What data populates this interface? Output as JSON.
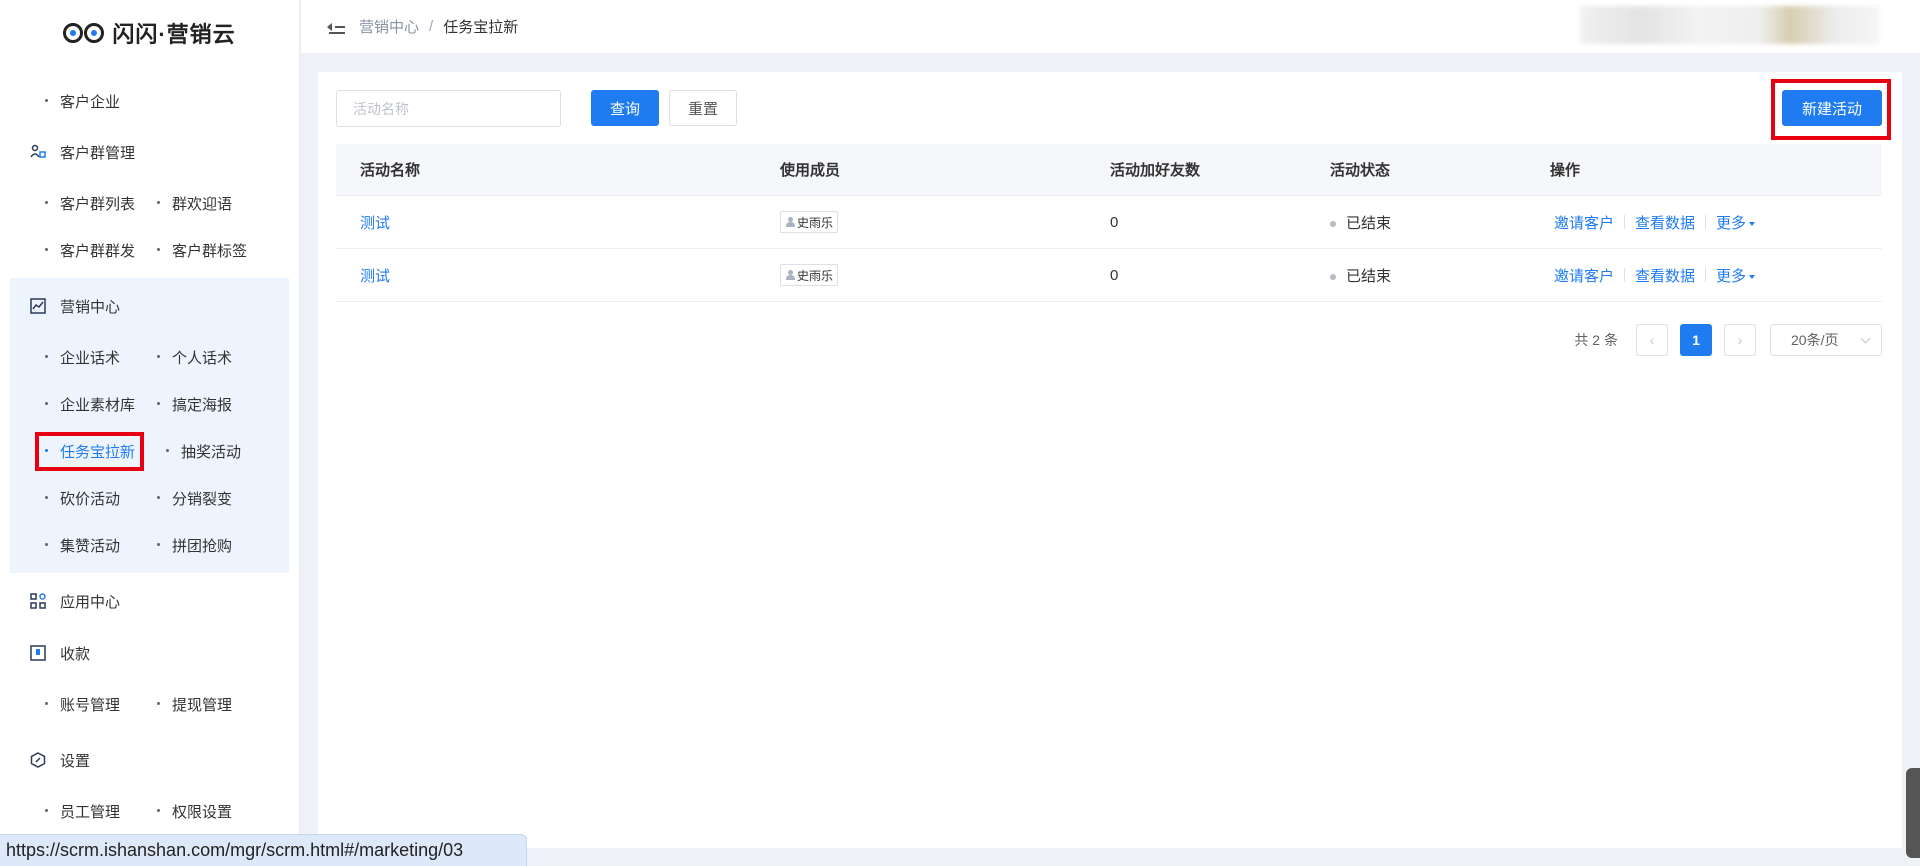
{
  "logo": {
    "text": "闪闪·营销云"
  },
  "sidebar": {
    "top_items": [
      "客户企业"
    ],
    "groups": [
      {
        "title": "客户群管理",
        "icon": "group-users-icon",
        "rows": [
          [
            "客户群列表",
            "群欢迎语"
          ],
          [
            "客户群群发",
            "客户群标签"
          ]
        ]
      },
      {
        "title": "营销中心",
        "icon": "chart-line-icon",
        "rows": [
          [
            "企业话术",
            "个人话术"
          ],
          [
            "企业素材库",
            "搞定海报"
          ],
          [
            "任务宝拉新",
            "抽奖活动"
          ],
          [
            "砍价活动",
            "分销裂变"
          ],
          [
            "集赞活动",
            "拼团抢购"
          ]
        ],
        "active_item": "任务宝拉新"
      },
      {
        "title": "应用中心",
        "icon": "apps-grid-icon",
        "rows": []
      },
      {
        "title": "收款",
        "icon": "wallet-icon",
        "rows": [
          [
            "账号管理",
            "提现管理"
          ]
        ]
      },
      {
        "title": "设置",
        "icon": "settings-hex-icon",
        "rows": [
          [
            "员工管理",
            "权限设置"
          ]
        ]
      }
    ]
  },
  "breadcrumb": {
    "parent": "营销中心",
    "separator": "/",
    "current": "任务宝拉新"
  },
  "toolbar": {
    "search_placeholder": "活动名称",
    "search_value": "",
    "query_label": "查询",
    "reset_label": "重置",
    "new_label": "新建活动"
  },
  "table": {
    "headers": [
      "活动名称",
      "使用成员",
      "活动加好友数",
      "活动状态",
      "操作"
    ],
    "rows": [
      {
        "name": "测试",
        "member": "史雨乐",
        "friends": "0",
        "status": "已结束"
      },
      {
        "name": "测试",
        "member": "史雨乐",
        "friends": "0",
        "status": "已结束"
      }
    ],
    "ops": {
      "invite": "邀请客户",
      "view": "查看数据",
      "more": "更多"
    }
  },
  "pagination": {
    "total": "共 2 条",
    "current_page": "1",
    "page_size": "20条/页",
    "prev": "‹",
    "next": "›"
  },
  "status_bar": {
    "url": "https://scrm.ishanshan.com/mgr/scrm.html#/marketing/03"
  },
  "colors": {
    "accent": "#1f7cf0",
    "highlight_box": "#e60012",
    "sidebar_active_bg": "#eef4fd"
  }
}
